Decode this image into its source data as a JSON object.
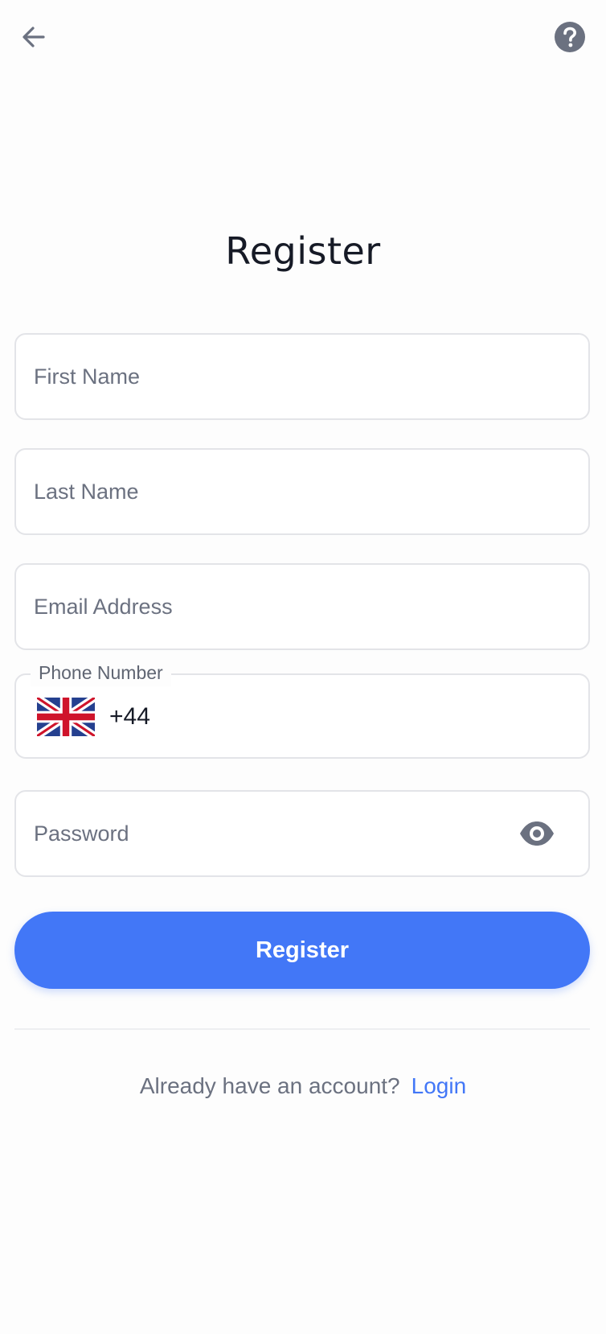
{
  "header": {
    "back_icon": "arrow-left-icon",
    "help_icon": "question-circle-icon"
  },
  "page": {
    "title": "Register"
  },
  "form": {
    "first_name": {
      "placeholder": "First Name",
      "value": ""
    },
    "last_name": {
      "placeholder": "Last Name",
      "value": ""
    },
    "email": {
      "placeholder": "Email Address",
      "value": ""
    },
    "phone": {
      "label": "Phone Number",
      "country_flag": "uk-flag-icon",
      "country_code": "+44",
      "value": ""
    },
    "password": {
      "placeholder": "Password",
      "value": "",
      "toggle_icon": "eye-icon"
    },
    "submit_label": "Register"
  },
  "footer": {
    "prompt": "Already have an account?",
    "login_label": "Login"
  },
  "colors": {
    "accent": "#4277f7",
    "background": "#fdfdfd",
    "border": "#e3e4e8",
    "icon": "#6b7180"
  }
}
